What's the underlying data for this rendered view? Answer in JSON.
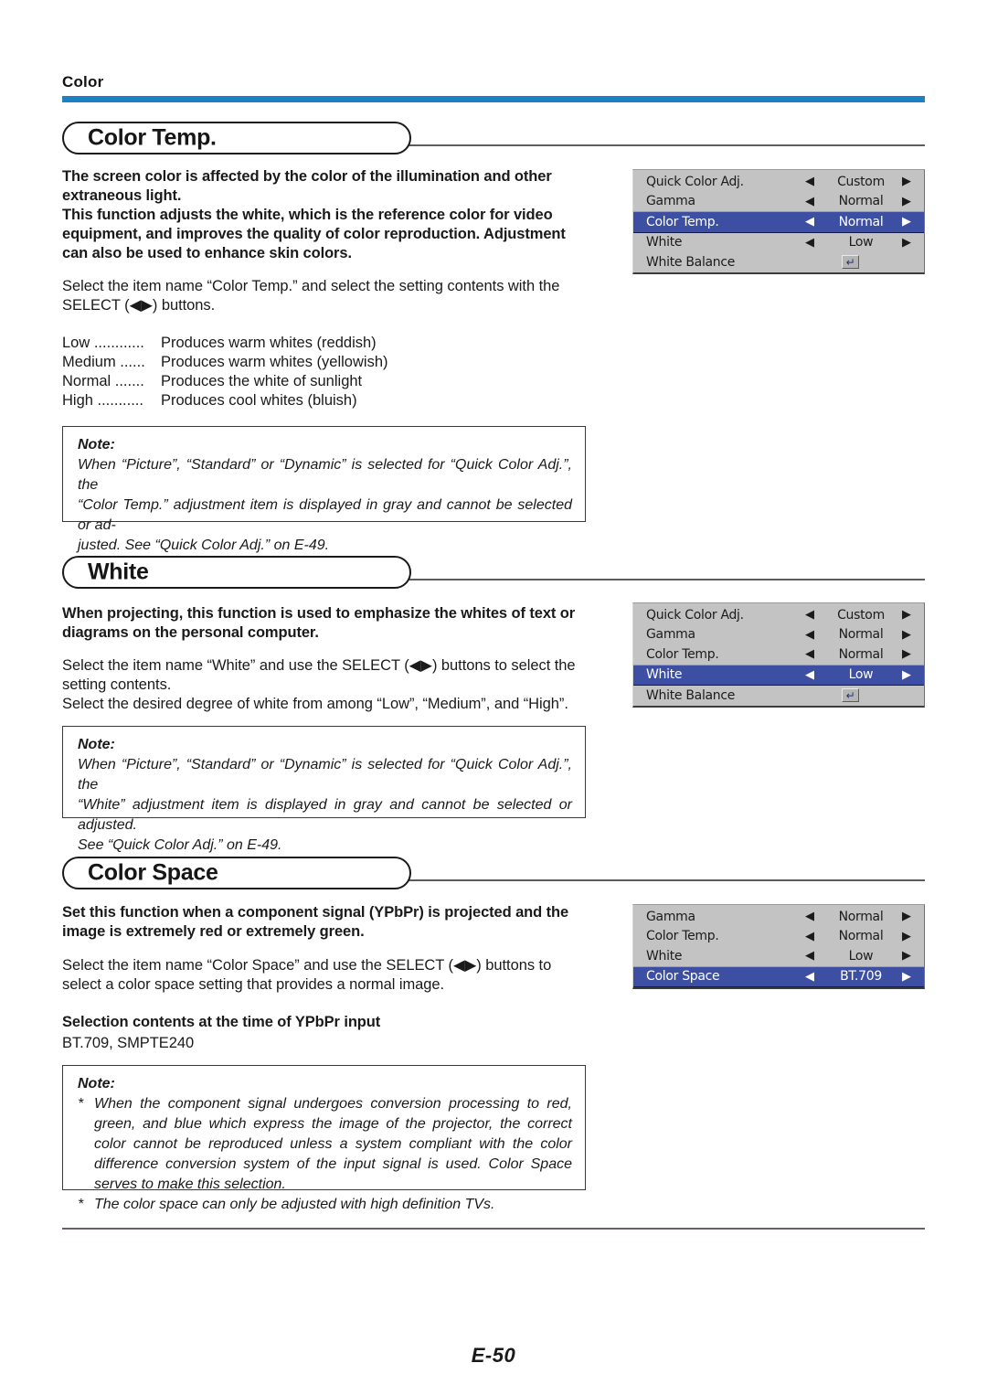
{
  "running_head": "Color",
  "accent_color": "#1d7fc4",
  "osd_highlight_color": "#3c4fa2",
  "osd_background_color": "#c3c3c3",
  "page_number": "E-50",
  "sections": [
    {
      "title": "Color Temp.",
      "bold_paragraph": "The screen color is affected by the color of the illumination and other\nextraneous light.\nThis function adjusts the white, which is the reference color for video\nequipment, and improves the quality of color reproduction. Adjustment\ncan also be used to enhance skin colors.",
      "regular_paragraph": "Select the item name “Color Temp.” and select the setting contents with the\nSELECT (◀▶) buttons.",
      "definitions": [
        {
          "term": "Low ............",
          "desc": "Produces warm whites (reddish)"
        },
        {
          "term": "Medium ......",
          "desc": "Produces warm whites (yellowish)"
        },
        {
          "term": "Normal .......",
          "desc": "Produces the white of sunlight"
        },
        {
          "term": "High ...........",
          "desc": "Produces cool whites (bluish)"
        }
      ],
      "note": {
        "label": "Note:",
        "lines": [
          "When “Picture”, “Standard” or “Dynamic” is selected for “Quick Color Adj.”, the",
          "“Color Temp.” adjustment item is displayed in gray and cannot be selected or ad-",
          "justed. See “Quick Color Adj.” on E-49."
        ]
      }
    },
    {
      "title": "White",
      "bold_paragraph": "When projecting, this function is used to emphasize the whites of text or\ndiagrams on the personal computer.",
      "regular_paragraph": "Select the item name “White” and use the SELECT (◀▶) buttons to select the\nsetting contents.\nSelect the desired degree of white from among “Low”, “Medium”, and “High”.",
      "note": {
        "label": "Note:",
        "lines": [
          "When “Picture”, “Standard” or “Dynamic” is selected for “Quick Color Adj.”, the",
          "“White” adjustment item is displayed in gray and cannot be selected or adjusted.",
          "See “Quick Color Adj.” on E-49."
        ]
      }
    },
    {
      "title": "Color Space",
      "bold_paragraph": "Set this function when a component signal (YPbPr) is projected and the\nimage is extremely red or extremely green.",
      "regular_paragraph": "Select the item name “Color Space” and use the SELECT (◀▶) buttons to\nselect a color space setting that provides a normal image.",
      "selection_heading": "Selection contents at the time of YPbPr input",
      "selection_values": "BT.709, SMPTE240",
      "note": {
        "label": "Note:",
        "bullets": [
          {
            "marker": "*",
            "text": "When the component signal undergoes conversion processing to red, green, and blue which express the image of the projector, the correct color cannot be reproduced unless a system compliant with the color difference conversion system of the input signal is used. Color Space serves to make this selection."
          },
          {
            "marker": "*",
            "text": "The color space can only be adjusted with high definition TVs."
          }
        ]
      }
    }
  ],
  "osd_menus": [
    {
      "name": "color-temp-menu",
      "rows": [
        {
          "label": "Quick Color Adj.",
          "value": "Custom",
          "type": "select",
          "selected": false
        },
        {
          "label": "Gamma",
          "value": "Normal",
          "type": "select",
          "selected": false
        },
        {
          "label": "Color Temp.",
          "value": "Normal",
          "type": "select",
          "selected": true
        },
        {
          "label": "White",
          "value": "Low",
          "type": "select",
          "selected": false
        },
        {
          "label": "White Balance",
          "value": "",
          "type": "enter",
          "selected": false
        }
      ]
    },
    {
      "name": "white-menu",
      "rows": [
        {
          "label": "Quick Color Adj.",
          "value": "Custom",
          "type": "select",
          "selected": false
        },
        {
          "label": "Gamma",
          "value": "Normal",
          "type": "select",
          "selected": false
        },
        {
          "label": "Color Temp.",
          "value": "Normal",
          "type": "select",
          "selected": false
        },
        {
          "label": "White",
          "value": "Low",
          "type": "select",
          "selected": true
        },
        {
          "label": "White Balance",
          "value": "",
          "type": "enter",
          "selected": false
        }
      ]
    },
    {
      "name": "color-space-menu",
      "rows": [
        {
          "label": "Gamma",
          "value": "Normal",
          "type": "select",
          "selected": false
        },
        {
          "label": "Color Temp.",
          "value": "Normal",
          "type": "select",
          "selected": false
        },
        {
          "label": "White",
          "value": "Low",
          "type": "select",
          "selected": false
        },
        {
          "label": "Color Space",
          "value": "BT.709",
          "type": "select",
          "selected": true
        }
      ]
    }
  ],
  "icons": {
    "arrow_left": "◀",
    "arrow_right": "▶",
    "enter": "↵"
  }
}
